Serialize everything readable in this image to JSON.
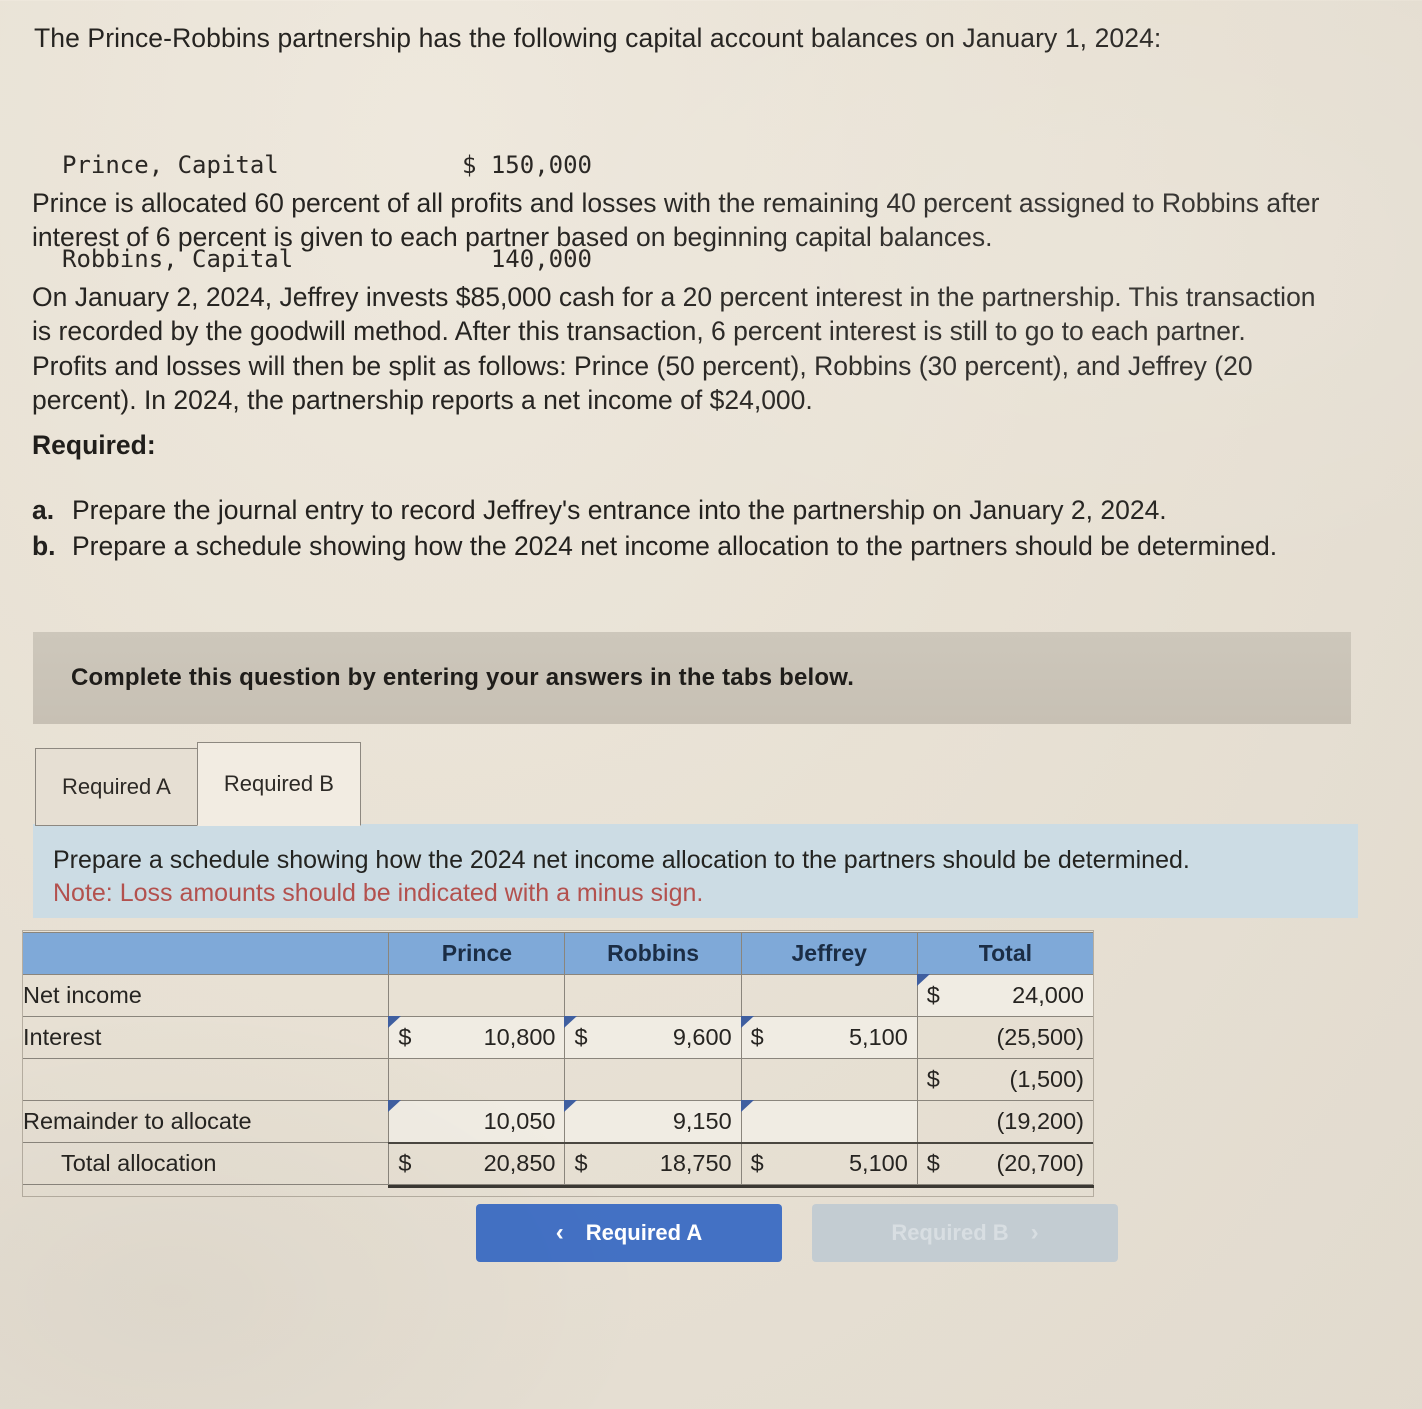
{
  "problem": {
    "intro": "The Prince-Robbins partnership has the following capital account balances on January 1, 2024:",
    "capital_accounts": [
      {
        "name": "Prince, Capital",
        "symbol": "$ ",
        "amount": "150,000"
      },
      {
        "name": "Robbins, Capital",
        "symbol": "",
        "amount": "140,000"
      }
    ],
    "paragraph_1": "Prince is allocated 60 percent of all profits and losses with the remaining 40 percent assigned to Robbins after interest of 6 percent is given to each partner based on beginning capital balances.",
    "paragraph_2": "On January 2, 2024, Jeffrey invests $85,000 cash for a 20 percent interest in the partnership. This transaction is recorded by the goodwill method. After this transaction, 6 percent interest is still to go to each partner. Profits and losses will then be split as follows: Prince (50 percent), Robbins (30 percent), and Jeffrey (20 percent). In 2024, the partnership reports a net income of $24,000.",
    "required_heading": "Required:",
    "required_items": [
      {
        "marker": "a.",
        "text": "Prepare the journal entry to record Jeffrey's entrance into the partnership on January 2, 2024."
      },
      {
        "marker": "b.",
        "text": "Prepare a schedule showing how the 2024 net income allocation to the partners should be determined."
      }
    ]
  },
  "banner": {
    "text": "Complete this question by entering your answers in the tabs below."
  },
  "tabs": {
    "items": [
      {
        "label": "Required A",
        "active": false
      },
      {
        "label": "Required B",
        "active": true
      }
    ]
  },
  "info_panel": {
    "instruction": "Prepare a schedule showing how the 2024 net income allocation to the partners should be determined.",
    "note": "Note: Loss amounts should be indicated with a minus sign.",
    "note_color": "#b3514e"
  },
  "schedule": {
    "columns": [
      "",
      "Prince",
      "Robbins",
      "Jeffrey",
      "Total"
    ],
    "header_bg": "#7fa9d8",
    "rows": [
      {
        "label": "Net income",
        "indent": false,
        "cells": [
          {
            "symbol": "",
            "value": "",
            "input": false
          },
          {
            "symbol": "",
            "value": "",
            "input": false
          },
          {
            "symbol": "",
            "value": "",
            "input": false
          },
          {
            "symbol": "$",
            "value": "24,000",
            "input": true
          }
        ]
      },
      {
        "label": "Interest",
        "indent": false,
        "cells": [
          {
            "symbol": "$",
            "value": "10,800",
            "input": true
          },
          {
            "symbol": "$",
            "value": "9,600",
            "input": true
          },
          {
            "symbol": "$",
            "value": "5,100",
            "input": true
          },
          {
            "symbol": "",
            "value": "(25,500)",
            "input": false
          }
        ]
      },
      {
        "label": "",
        "indent": false,
        "cells": [
          {
            "symbol": "",
            "value": "",
            "input": false
          },
          {
            "symbol": "",
            "value": "",
            "input": false
          },
          {
            "symbol": "",
            "value": "",
            "input": false
          },
          {
            "symbol": "$",
            "value": "(1,500)",
            "input": false
          }
        ]
      },
      {
        "label": "Remainder to allocate",
        "indent": false,
        "cells": [
          {
            "symbol": "",
            "value": "10,050",
            "input": true
          },
          {
            "symbol": "",
            "value": "9,150",
            "input": true
          },
          {
            "symbol": "",
            "value": "",
            "input": true
          },
          {
            "symbol": "",
            "value": "(19,200)",
            "input": false
          }
        ]
      },
      {
        "label": "Total allocation",
        "indent": true,
        "total": true,
        "cells": [
          {
            "symbol": "$",
            "value": "20,850",
            "input": false
          },
          {
            "symbol": "$",
            "value": "18,750",
            "input": false
          },
          {
            "symbol": "$",
            "value": "5,100",
            "input": false
          },
          {
            "symbol": "$",
            "value": "(20,700)",
            "input": false
          }
        ]
      }
    ]
  },
  "navigation": {
    "prev": {
      "label": "Required A",
      "icon": "chevron-left",
      "glyph": "‹",
      "enabled": true,
      "color": "#4371c4"
    },
    "next": {
      "label": "Required B",
      "icon": "chevron-right",
      "glyph": "›",
      "enabled": false,
      "color": "#c3ccd2"
    }
  }
}
